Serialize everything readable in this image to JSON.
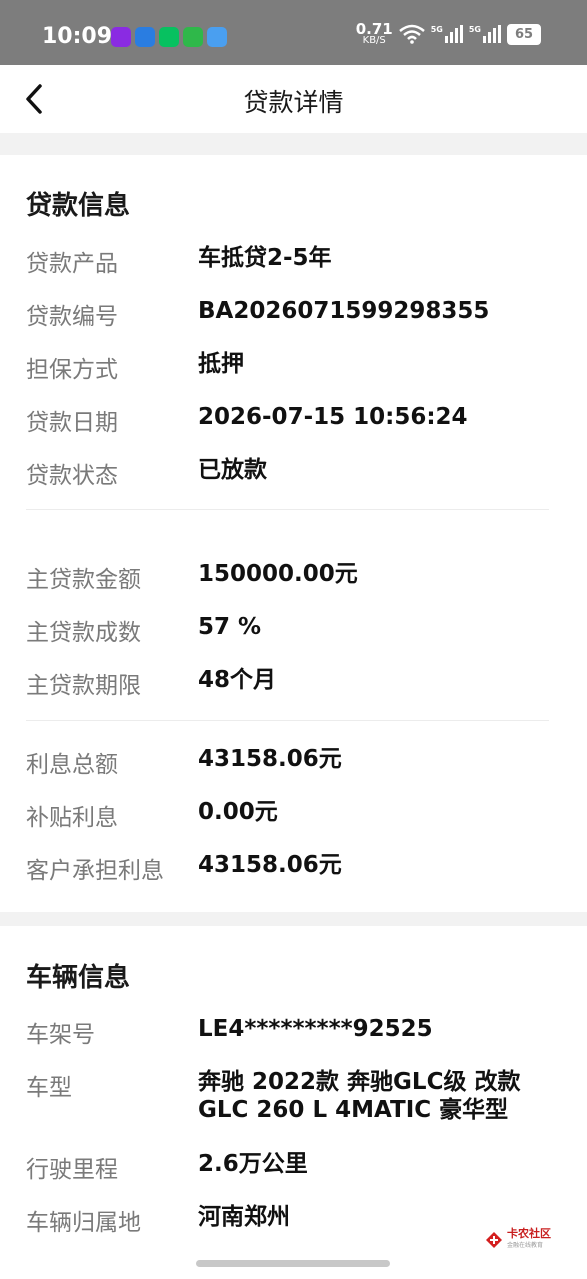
{
  "status_bar": {
    "time": "10:09",
    "net_speed_value": "0.71",
    "net_speed_unit": "KB/S",
    "signal1": "5G",
    "signal2": "5G",
    "battery": "65",
    "notification_colors": [
      "#8a2be2",
      "#2a7de1",
      "#07c160",
      "#2fb84a",
      "#4a9ff0"
    ]
  },
  "header": {
    "title": "贷款详情"
  },
  "loan": {
    "section_title": "贷款信息",
    "rows": [
      {
        "label": "贷款产品",
        "value": "车抵贷2-5年"
      },
      {
        "label": "贷款编号",
        "value": "BA2026071599298355"
      },
      {
        "label": "担保方式",
        "value": "抵押"
      },
      {
        "label": "贷款日期",
        "value": "2026-07-15 10:56:24"
      },
      {
        "label": "贷款状态",
        "value": "已放款"
      },
      {
        "label": "主贷款金额",
        "value": "150000.00元"
      },
      {
        "label": "主贷款成数",
        "value": "57 %"
      },
      {
        "label": "主贷款期限",
        "value": "48个月"
      },
      {
        "label": "利息总额",
        "value": "43158.06元"
      },
      {
        "label": "补贴利息",
        "value": "0.00元"
      },
      {
        "label": "客户承担利息",
        "value": "43158.06元"
      }
    ]
  },
  "vehicle": {
    "section_title": "车辆信息",
    "rows": [
      {
        "label": "车架号",
        "value": "LE4*********92525"
      },
      {
        "label": "车型",
        "value": "奔驰 2022款 奔驰GLC级 改款 GLC 260 L 4MATIC 豪华型"
      },
      {
        "label": "行驶里程",
        "value": "2.6万公里"
      },
      {
        "label": "车辆归属地",
        "value": "河南郑州"
      }
    ]
  },
  "watermark": {
    "name": "卡农社区",
    "sub": "金融在线教育"
  }
}
